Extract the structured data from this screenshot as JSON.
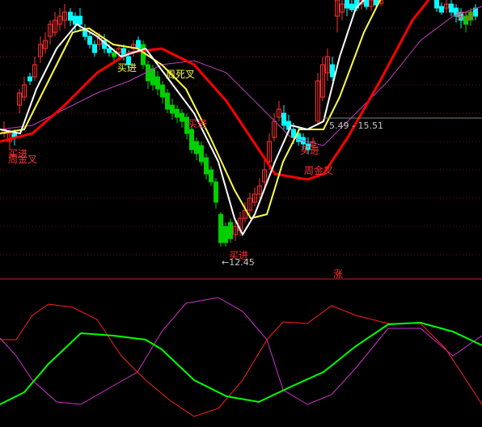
{
  "chart_data": [
    {
      "type": "candlestick",
      "title": "",
      "colors": {
        "up": "#ff3030",
        "down": "#00ffff",
        "down_body": "#00d000",
        "ma5": "#ffffff",
        "ma10": "#ffff40",
        "ma20": "#ff0000",
        "ma60": "#c040c0"
      },
      "annotations": {
        "buy_1": "买进",
        "golden_1": "周金叉",
        "buy_2": "买进",
        "death": "周死叉",
        "buy_3": "买进",
        "buy_4": "买进",
        "golden_2": "周金叉",
        "buy_5": "买进",
        "buy_6": "买进",
        "low_marker": "←12.45",
        "cursor_readout": "5.49 - 15.51",
        "rise_label": "涨"
      }
    },
    {
      "type": "line",
      "title": "",
      "series": [
        {
          "color": "#00ff00"
        },
        {
          "color": "#ff2020"
        },
        {
          "color": "#d030d0"
        }
      ]
    }
  ]
}
